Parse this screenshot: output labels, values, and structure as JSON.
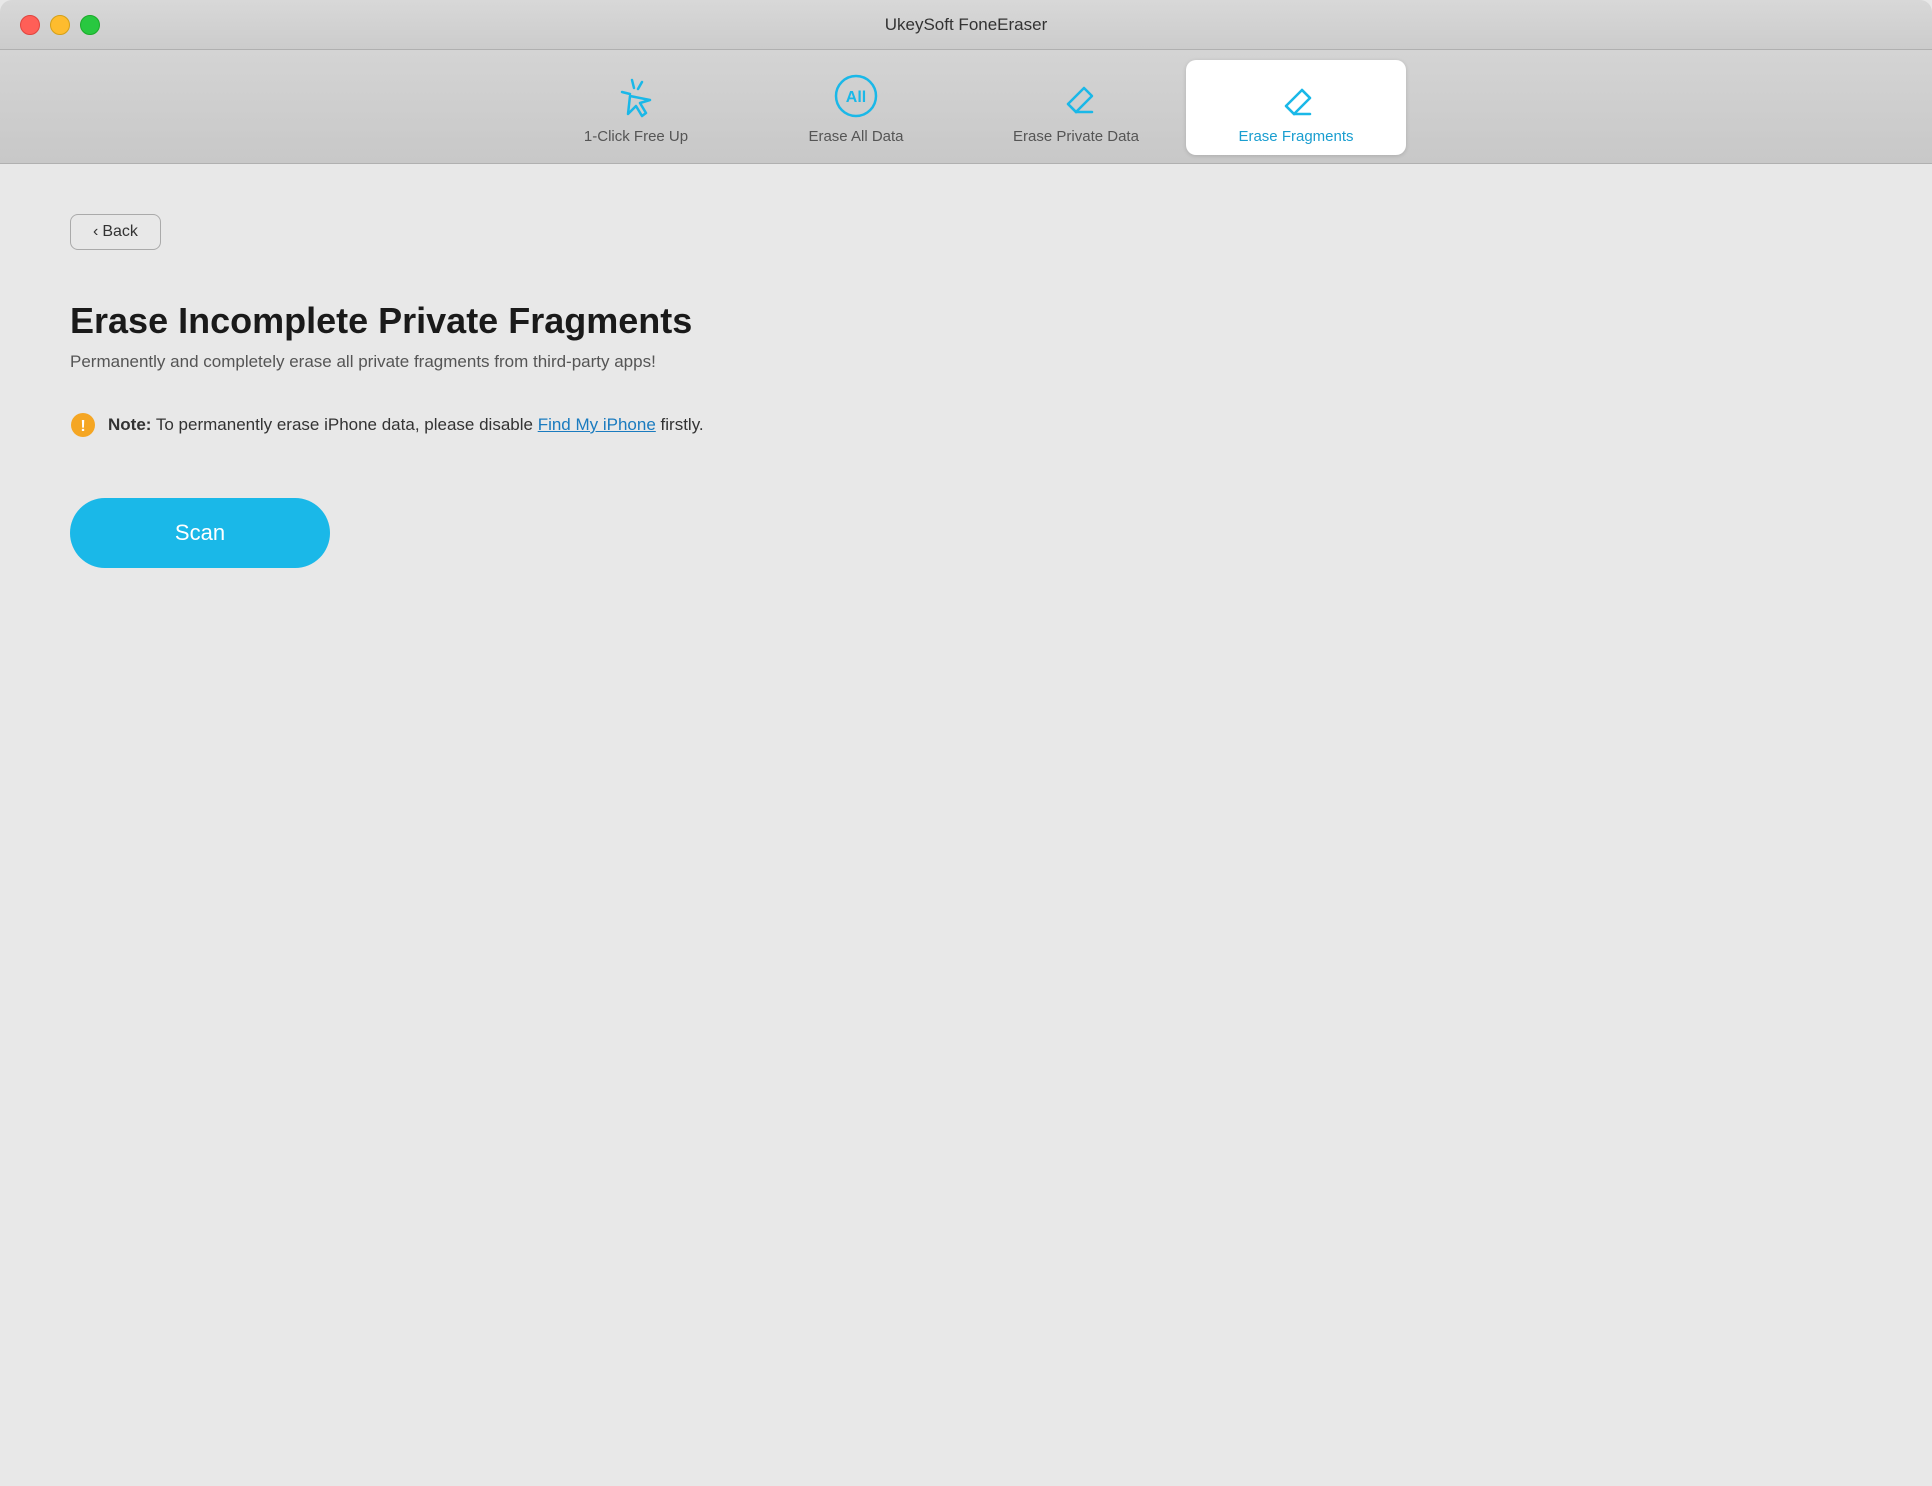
{
  "window": {
    "title": "UkeySoft FoneEraser"
  },
  "toolbar": {
    "tabs": [
      {
        "id": "one-click",
        "label": "1-Click Free Up",
        "active": false
      },
      {
        "id": "erase-all",
        "label": "Erase All Data",
        "active": false
      },
      {
        "id": "erase-private",
        "label": "Erase Private Data",
        "active": false
      },
      {
        "id": "erase-fragments",
        "label": "Erase Fragments",
        "active": true
      }
    ]
  },
  "back_button": {
    "label": "Back"
  },
  "content": {
    "title": "Erase Incomplete Private Fragments",
    "subtitle": "Permanently and completely erase all private fragments from third-party apps!",
    "note_label": "Note:",
    "note_text": "To permanently erase iPhone data, please disable ",
    "note_link": "Find My iPhone",
    "note_suffix": " firstly.",
    "scan_button": "Scan"
  }
}
